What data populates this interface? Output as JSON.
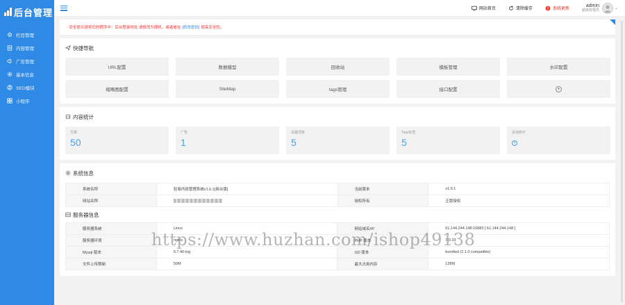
{
  "brand": {
    "title": "后台管理"
  },
  "sidebar": {
    "items": [
      {
        "label": "栏目管理",
        "icon": "gear-icon"
      },
      {
        "label": "内容管理",
        "icon": "document-icon"
      },
      {
        "label": "广告管理",
        "icon": "megaphone-icon"
      },
      {
        "label": "基本信息",
        "icon": "settings-icon"
      },
      {
        "label": "SEO模块",
        "icon": "seo-icon"
      },
      {
        "label": "小程序",
        "icon": "grid-icon"
      }
    ]
  },
  "topbar": {
    "site_home": "网站首页",
    "clear_cache": "清除缓存",
    "system_update": "系统更新",
    "user_name": "admin",
    "user_role": "超级管理员"
  },
  "notice": {
    "prefix": "- 安全提示请将您的程序中：",
    "middle": "后台登录地址 请修改为随机，或者是在",
    "link": "[修改密码]",
    "suffix": "提高安全性。"
  },
  "quick_nav": {
    "title": "快捷导航",
    "items": [
      "URL配置",
      "数据模型",
      "回收站",
      "模板管理",
      "水印配置",
      "缩略图配置",
      "SiteMap",
      "tags管理",
      "接口配置"
    ]
  },
  "content_stats": {
    "title": "内容统计",
    "items": [
      {
        "label": "文章",
        "value": "50"
      },
      {
        "label": "广告",
        "value": "1"
      },
      {
        "label": "关键词条",
        "value": "5"
      },
      {
        "label": "Tags标签",
        "value": "5"
      },
      {
        "label": "添加统计"
      }
    ]
  },
  "system_info": {
    "title": "系统信息",
    "rows": [
      {
        "k1": "系统名称",
        "v1": "轻易内容管理系统v1.6.1[商业版]",
        "k2": "当前版本",
        "v2": "v1.6.1"
      },
      {
        "k1": "网站名称",
        "v1": "",
        "k2": "授权所有",
        "v2": "正版授权"
      }
    ]
  },
  "server_info": {
    "title": "服务器信息",
    "rows": [
      {
        "k1": "服务器系统",
        "v1": "Linux",
        "k2": "网站域名/IP",
        "v2": "61.144.244.148:16883 [ 61.144.244.148 ]"
      },
      {
        "k1": "服务器环境",
        "v1": "nginx",
        "k2": "PHP 版本",
        "v2": "7.0.33"
      },
      {
        "k1": "Mysql 版本",
        "v1": "5.7.40-log",
        "k2": "GD 版本",
        "v2": "bundled (2.1.0 compatible)"
      },
      {
        "k1": "文件上传限制",
        "v1": "50M",
        "k2": "最大占用内存",
        "v2": "128M"
      }
    ]
  },
  "watermark": "https://www.huzhan.com/ishop49138"
}
